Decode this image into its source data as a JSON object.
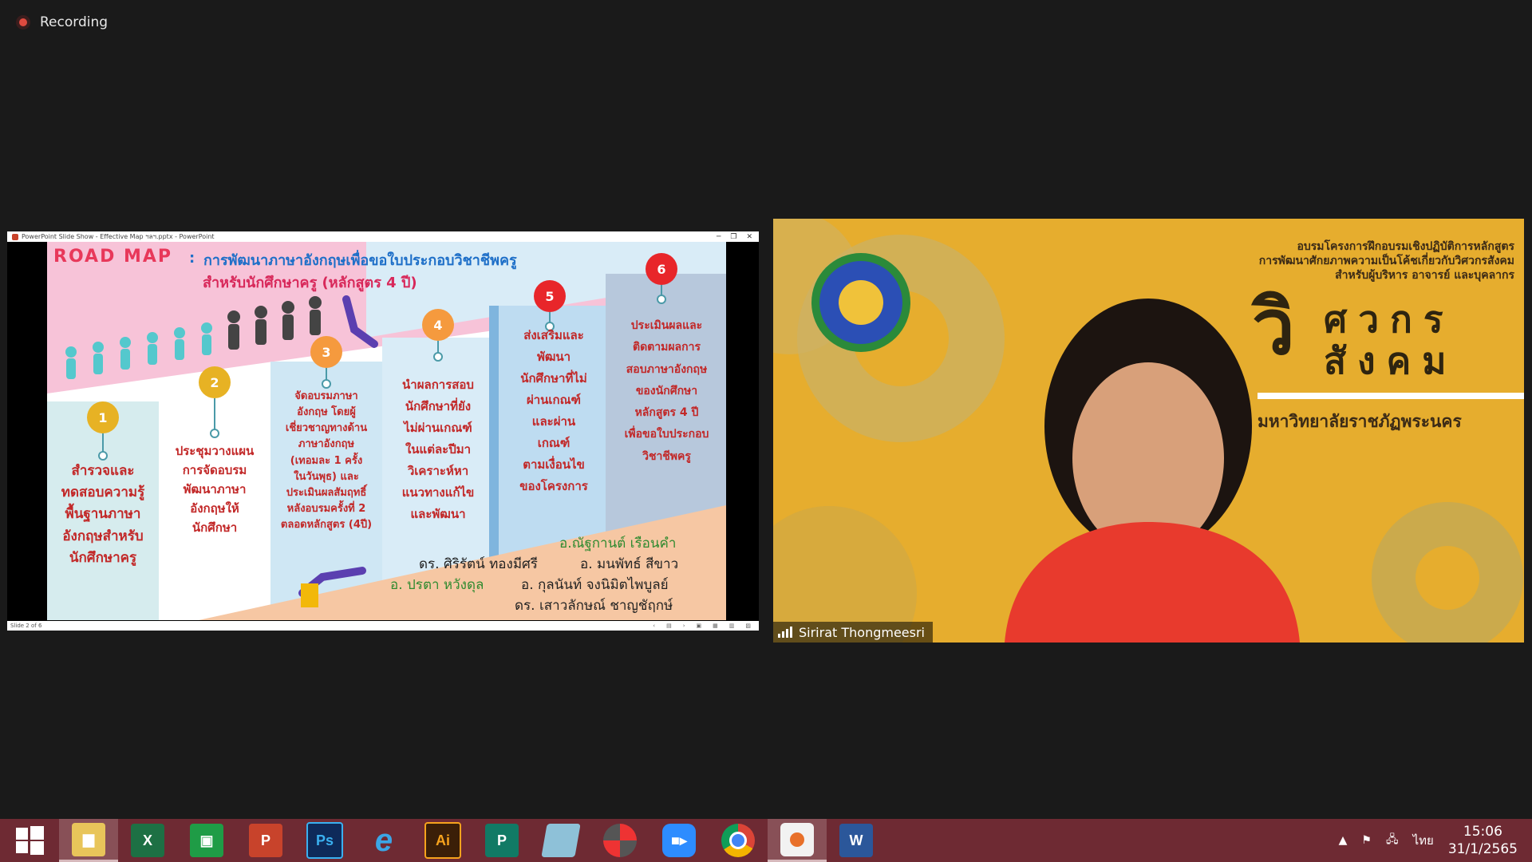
{
  "recording": {
    "label": "Recording"
  },
  "share": {
    "window_title": "PowerPoint Slide Show  -  Effective  Map  ฯลฯ.pptx  -  PowerPoint",
    "status_left": "Slide 2 of 6",
    "slide": {
      "title": "ROAD  MAP",
      "colon": ":",
      "subtitle_line1": "การพัฒนาภาษาอังกฤษเพื่อขอใบประกอบวิชาชีพครู",
      "subtitle_line2": "สำหรับนักศึกษาครู (หลักสูตร 4 ปี)",
      "steps": [
        {
          "num": "1",
          "text": "สำรวจและ\nทดสอบความรู้\nพื้นฐานภาษา\nอังกฤษสำหรับ\nนักศึกษาครู"
        },
        {
          "num": "2",
          "text": "ประชุมวางแผน\nการจัดอบรม\nพัฒนาภาษา\nอังกฤษให้\nนักศึกษา"
        },
        {
          "num": "3",
          "text": "จัดอบรมภาษา\nอังกฤษ โดยผู้\nเชี่ยวชาญทางด้าน\nภาษาอังกฤษ\n(เทอมละ 1 ครั้ง\nในวันพุธ) และ\nประเมินผลสัมฤทธิ์\nหลังอบรมครั้งที่ 2\nตลอดหลักสูตร (4ปี)"
        },
        {
          "num": "4",
          "text": "นำผลการสอบ\nนักศึกษาที่ยัง\nไม่ผ่านเกณฑ์\nในแต่ละปีมา\nวิเคราะห์หา\nแนวทางแก้ไข\nและพัฒนา"
        },
        {
          "num": "5",
          "text": "ส่งเสริมและ\nพัฒนา\nนักศึกษาที่ไม่\nผ่านเกณฑ์\nและผ่าน\nเกณฑ์\nตามเงื่อนไข\nของโครงการ"
        },
        {
          "num": "6",
          "text": "ประเมินผลและ\nติดตามผลการ\nสอบภาษาอังกฤษ\nของนักศึกษา\nหลักสูตร 4 ปี\nเพื่อขอใบประกอบ\nวิชาชีพครู"
        }
      ],
      "credits": [
        "อ.ณัฐกานต์   เรือนคำ",
        "ดร. ศิริรัตน์   ทองมีศรี",
        "อ. มนพัทธ์   สีขาว",
        "อ. ปรตา   หวังดุล",
        "อ. กุลนันท์   จงนิมิตไพบูลย์",
        "ดร. เสาวลักษณ์   ชาญชัฤกษ์"
      ]
    }
  },
  "video": {
    "participant_name": "Sirirat Thongmeesri",
    "banner_line1": "อบรมโครงการฝึกอบรมเชิงปฏิบัติการหลักสูตร",
    "banner_line2": "การพัฒนาศักยภาพความเป็นโค้ชเกี่ยวกับวิศวกรสังคม",
    "banner_line3": "สำหรับผู้บริหาร อาจารย์ และบุคลากร",
    "big_char": "วิ",
    "big_line1": "ศวกร",
    "big_line2": "สังคม",
    "university": "มหาวิทยาลัยราชภัฏพระนคร"
  },
  "taskbar": {
    "apps": [
      "start-icon",
      "file-explorer-icon",
      "excel-icon",
      "store-icon",
      "powerpoint-icon",
      "photoshop-icon",
      "internet-explorer-icon",
      "illustrator-icon",
      "publisher-icon",
      "notepad-icon",
      "photoscape-icon",
      "zoom-icon",
      "chrome-icon",
      "slideshow-icon",
      "word-icon"
    ],
    "labels": {
      "excel": "X",
      "store": "▣",
      "powerpoint": "P",
      "photoshop": "Ps",
      "ie": "e",
      "illustrator": "Ai",
      "publisher": "P",
      "word": "W"
    },
    "language": "ไทย",
    "time": "15:06",
    "date": "31/1/2565"
  },
  "colors": {
    "taskbar": "#6e2a33",
    "video_bg": "#e6ad2e",
    "slide_red": "#c22828",
    "slide_blue": "#1e6fc8"
  }
}
